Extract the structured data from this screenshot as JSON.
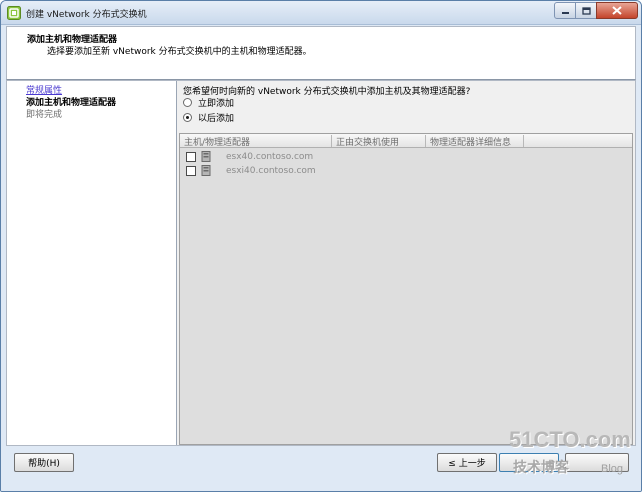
{
  "window": {
    "title": "创建 vNetwork 分布式交换机",
    "icon": "vmware-logo-icon"
  },
  "header": {
    "title": "添加主机和物理适配器",
    "subtitle": "选择要添加至新 vNetwork 分布式交换机中的主机和物理适配器。"
  },
  "nav": {
    "items": [
      {
        "label": "常规属性",
        "state": "link"
      },
      {
        "label": "添加主机和物理适配器",
        "state": "current"
      },
      {
        "label": "即将完成",
        "state": "pending"
      }
    ]
  },
  "main": {
    "question": "您希望何时向新的 vNetwork 分布式交换机中添加主机及其物理适配器?",
    "options": [
      {
        "label": "立即添加",
        "selected": false
      },
      {
        "label": "以后添加",
        "selected": true
      }
    ],
    "grid": {
      "columns": [
        "主机/物理适配器",
        "正由交换机使用",
        "物理适配器详细信息"
      ],
      "rows": [
        {
          "host": "esx40.contoso.com",
          "checked": false
        },
        {
          "host": "esxi40.contoso.com",
          "checked": false
        }
      ]
    }
  },
  "footer": {
    "help_label": "帮助(H)",
    "back_label": "≤ 上一步"
  },
  "watermark": {
    "main": "51CTO.com",
    "sub": "技术博客",
    "blog": "Blog"
  },
  "colors": {
    "link": "#4a3ad0",
    "chrome": "#dfe9f5",
    "close": "#c4442b"
  }
}
